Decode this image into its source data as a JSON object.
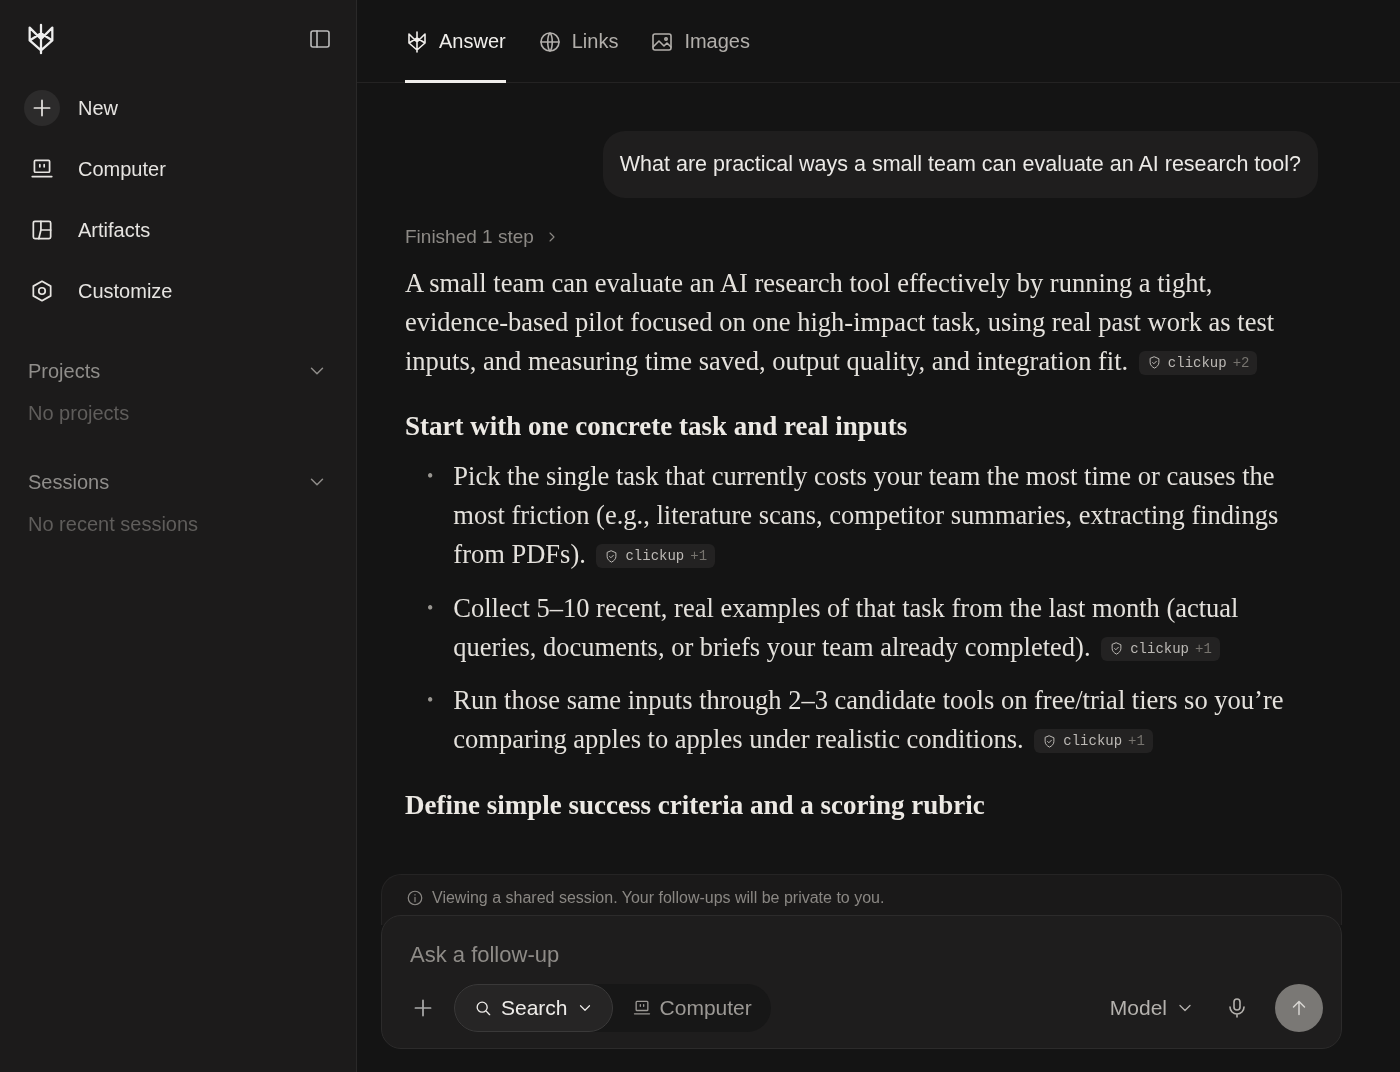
{
  "sidebar": {
    "items": [
      {
        "kind": "new",
        "label": "New"
      },
      {
        "kind": "computer",
        "label": "Computer"
      },
      {
        "kind": "artifacts",
        "label": "Artifacts"
      },
      {
        "kind": "customize",
        "label": "Customize"
      }
    ],
    "sections": [
      {
        "title": "Projects",
        "expanded": true,
        "empty_text": "No projects"
      },
      {
        "title": "Sessions",
        "expanded": true,
        "empty_text": "No recent sessions"
      }
    ]
  },
  "tabs": [
    {
      "kind": "answer",
      "label": "Answer",
      "selected": true
    },
    {
      "kind": "links",
      "label": "Links",
      "selected": false
    },
    {
      "kind": "images",
      "label": "Images",
      "selected": false
    }
  ],
  "query": "What are practical ways a small team can evaluate an AI research tool?",
  "steps": "Finished 1 step",
  "answer": {
    "intro": {
      "text": "A small team can evaluate an AI research tool effectively by running a tight, evidence-based pilot focused on one high-impact task, using real past work as test inputs, and measuring time saved, output quality, and integration fit.",
      "citation": {
        "source": "clickup",
        "extra": "+2"
      }
    },
    "sections": [
      {
        "heading": "Start with one concrete task and real inputs",
        "bullets": [
          {
            "marker": "•",
            "text": "Pick the single task that currently costs your team the most time or causes the most friction (e.g., literature scans, competitor summaries, extracting findings from PDFs).",
            "citation": {
              "source": "clickup",
              "extra": "+1"
            }
          },
          {
            "marker": "•",
            "text": "Collect 5–10 recent, real examples of that task from the last month (actual queries, documents, or briefs your team already completed).",
            "citation": {
              "source": "clickup",
              "extra": "+1"
            }
          },
          {
            "marker": "•",
            "text": "Run those same inputs through 2–3 candidate tools on free/trial tiers so you’re comparing apples to apples under realistic conditions.",
            "citation": {
              "source": "clickup",
              "extra": "+1"
            }
          }
        ]
      },
      {
        "heading": "Define simple success criteria and a scoring rubric"
      }
    ]
  },
  "notice": "Viewing a shared session. Your follow-ups will be private to you.",
  "composer": {
    "placeholder": "Ask a follow-up",
    "modes": [
      {
        "kind": "search",
        "label": "Search",
        "selected": true
      },
      {
        "kind": "computer",
        "label": "Computer",
        "selected": false
      }
    ],
    "model": "Model"
  }
}
